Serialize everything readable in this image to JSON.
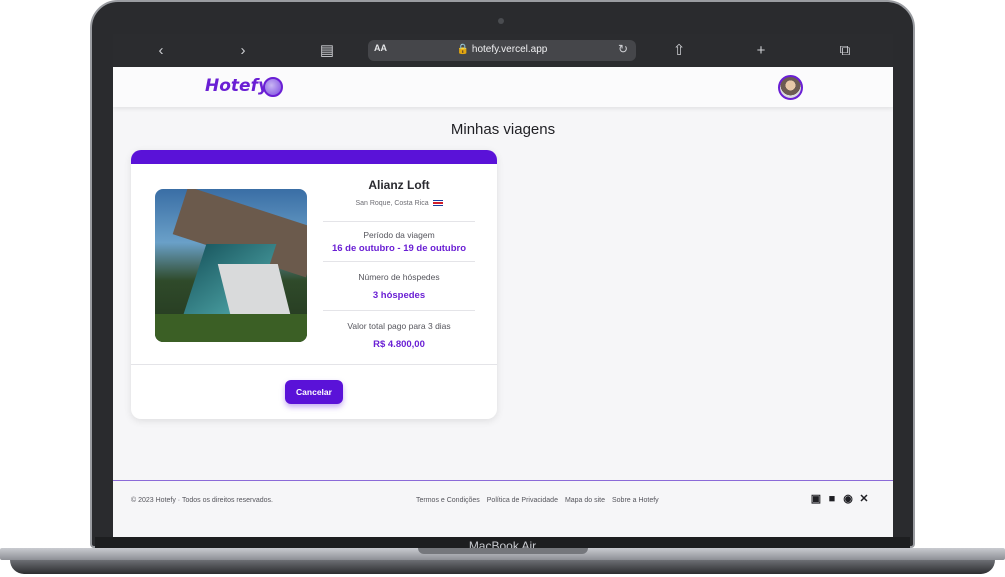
{
  "device": {
    "model_label": "MacBook Air"
  },
  "browser": {
    "reader_label": "AA",
    "url": "hotefy.vercel.app",
    "icons": [
      "back-icon",
      "forward-icon",
      "book-icon",
      "lock-icon",
      "reload-icon",
      "share-icon",
      "new-tab-icon",
      "tabs-icon"
    ]
  },
  "header": {
    "logo": "Hotefy"
  },
  "page": {
    "title": "Minhas viagens"
  },
  "trip": {
    "hotel_name": "Alianz Loft",
    "location": "San Roque, Costa Rica",
    "period_label": "Período da viagem",
    "period_start": "16 de outubro",
    "period_separator": "-",
    "period_end": "19 de outubro",
    "guests_label": "Número de hóspedes",
    "guests_value": "3 hóspedes",
    "total_label": "Valor total pago para 3 dias",
    "total_value": "R$ 4.800,00",
    "cancel_label": "Cancelar"
  },
  "footer": {
    "copyright": "© 2023 Hotefy · Todos os direitos reservados.",
    "links": [
      "Termos e Condições",
      "Política de Privacidade",
      "Mapa do site",
      "Sobre a Hotefy"
    ],
    "social_icons": [
      "instagram-icon",
      "linkedin-icon",
      "github-icon",
      "x-icon"
    ]
  },
  "colors": {
    "brand": "#5a12d8",
    "accent_text": "#6a1fd4"
  }
}
